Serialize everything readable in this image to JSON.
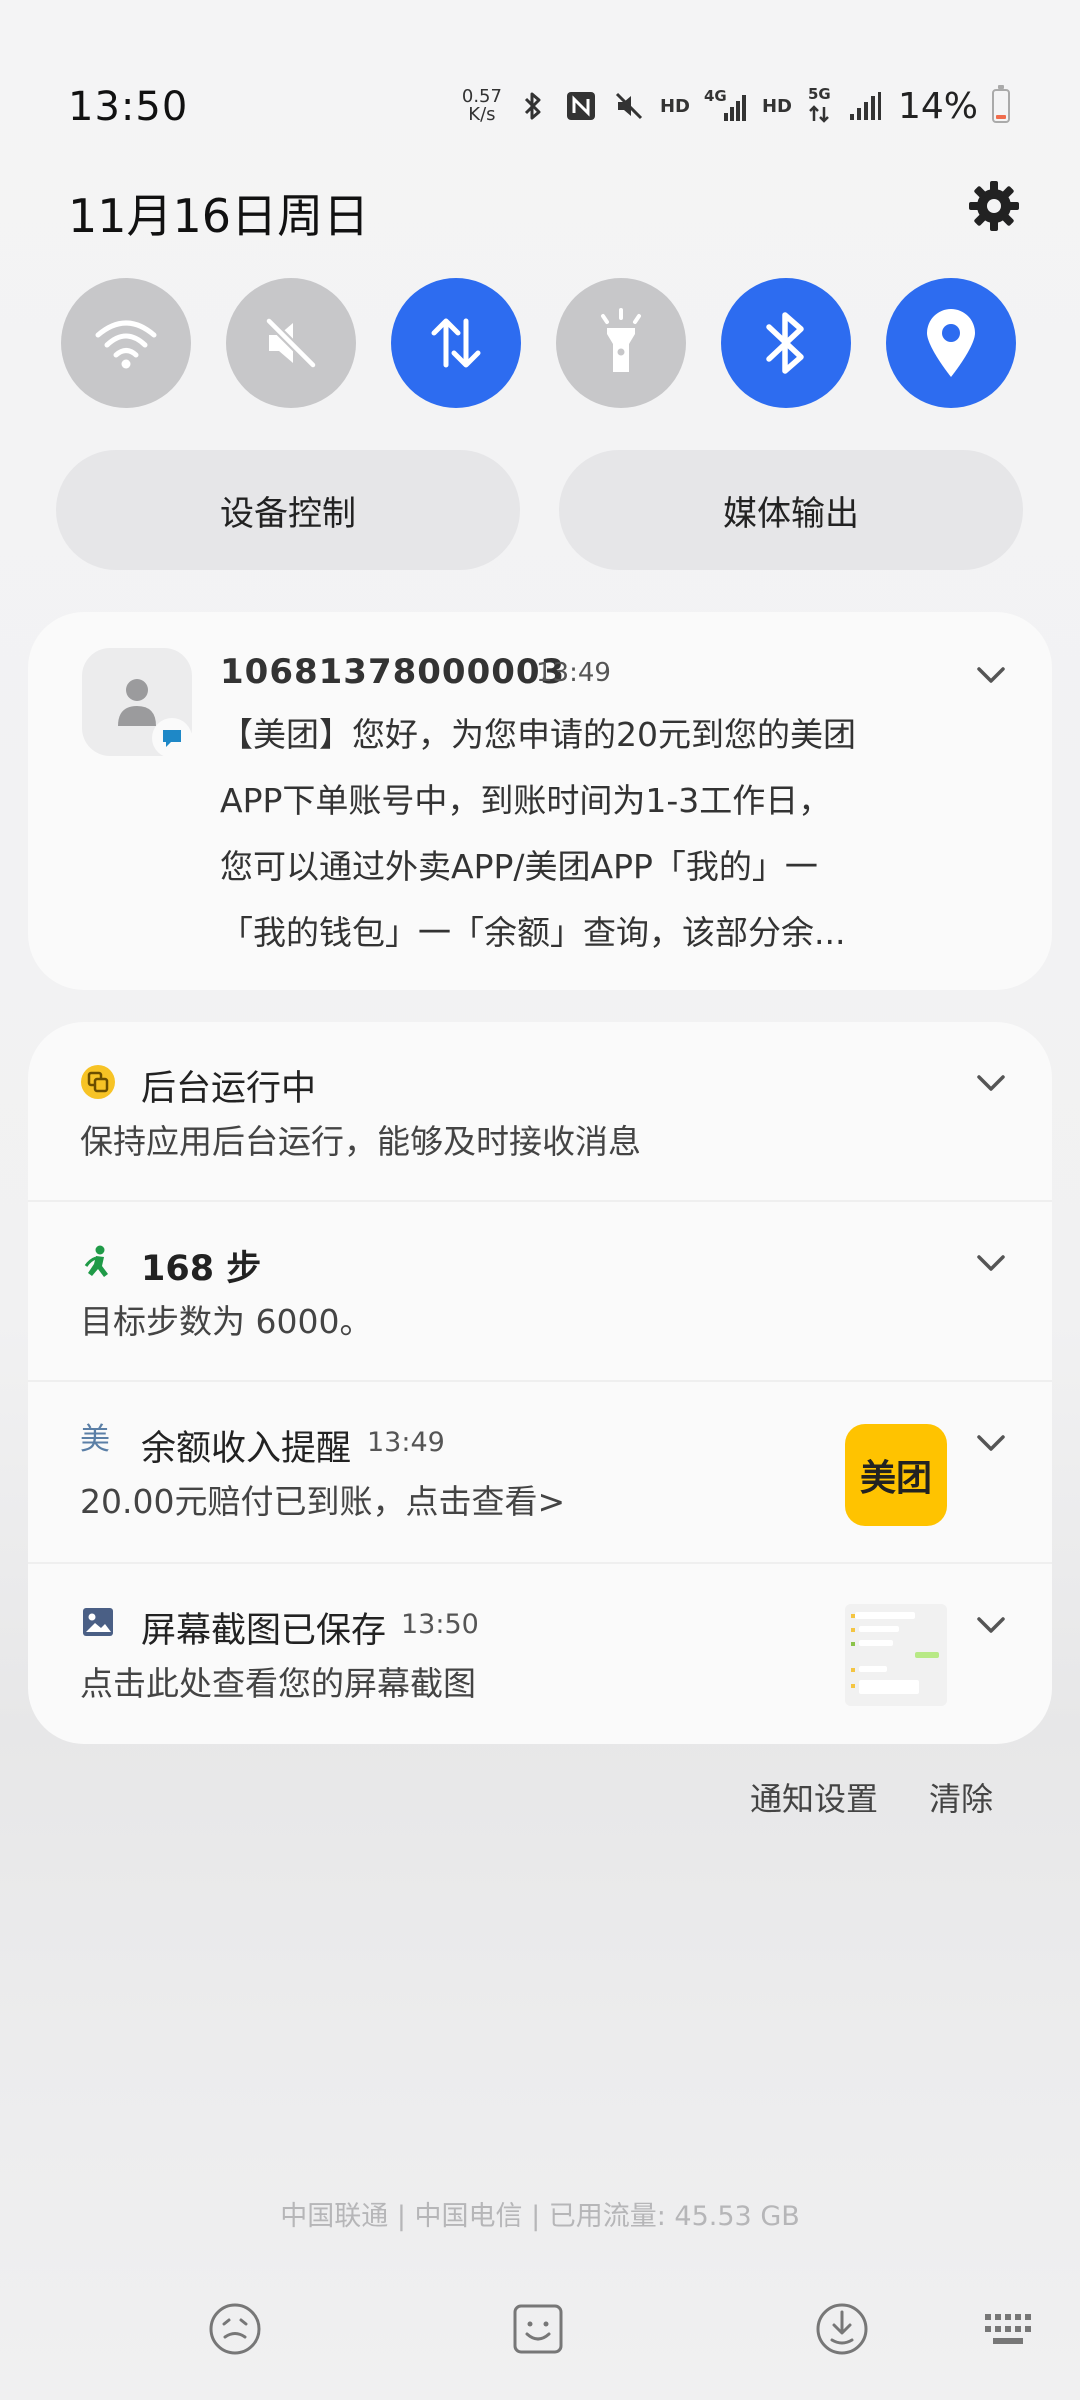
{
  "status_bar": {
    "time": "13:50",
    "net_speed_value": "0.57",
    "net_speed_unit": "K/s",
    "hd1": "HD",
    "net1": "4G",
    "hd2": "HD",
    "net2": "5G",
    "battery_percent": "14%",
    "battery_level": 0.14,
    "battery_color": "#f06c4d"
  },
  "header": {
    "date": "11月16日周日"
  },
  "quick_toggles": [
    {
      "name": "wifi",
      "icon": "wifi-icon",
      "on": false
    },
    {
      "name": "sound",
      "icon": "mute-icon",
      "on": false
    },
    {
      "name": "mobile-data",
      "icon": "data-transfer-icon",
      "on": true
    },
    {
      "name": "flashlight",
      "icon": "flashlight-icon",
      "on": false
    },
    {
      "name": "bluetooth",
      "icon": "bluetooth-icon",
      "on": true
    },
    {
      "name": "location",
      "icon": "location-icon",
      "on": true
    }
  ],
  "accent_color": "#2d6cf0",
  "pills": {
    "device_control": "设备控制",
    "media_output": "媒体输出"
  },
  "sms": {
    "sender": "10681378000003",
    "time": "13:49",
    "lines": [
      "【美团】您好，为您申请的20元到您的美团",
      "APP下单账号中，到账时间为1-3工作日，",
      "您可以通过外卖APP/美团APP「我的」一",
      "「我的钱包」一「余额」查询，该部分余..."
    ]
  },
  "notifications": {
    "background": {
      "title": "后台运行中",
      "subtitle": "保持应用后台运行，能够及时接收消息"
    },
    "steps": {
      "title": "168 步",
      "subtitle": "目标步数为 6000。"
    },
    "balance": {
      "app_glyph": "美",
      "title": "余额收入提醒",
      "time": "13:49",
      "subtitle": "20.00元赔付已到账，点击查看>",
      "logo_text": "美团",
      "logo_color": "#ffc300"
    },
    "screenshot": {
      "title": "屏幕截图已保存",
      "time": "13:50",
      "subtitle": "点击此处查看您的屏幕截图"
    }
  },
  "actions": {
    "settings": "通知设置",
    "clear": "清除"
  },
  "footer": {
    "carrier_info": "中国联通 | 中国电信 | 已用流量: 45.53 GB"
  }
}
